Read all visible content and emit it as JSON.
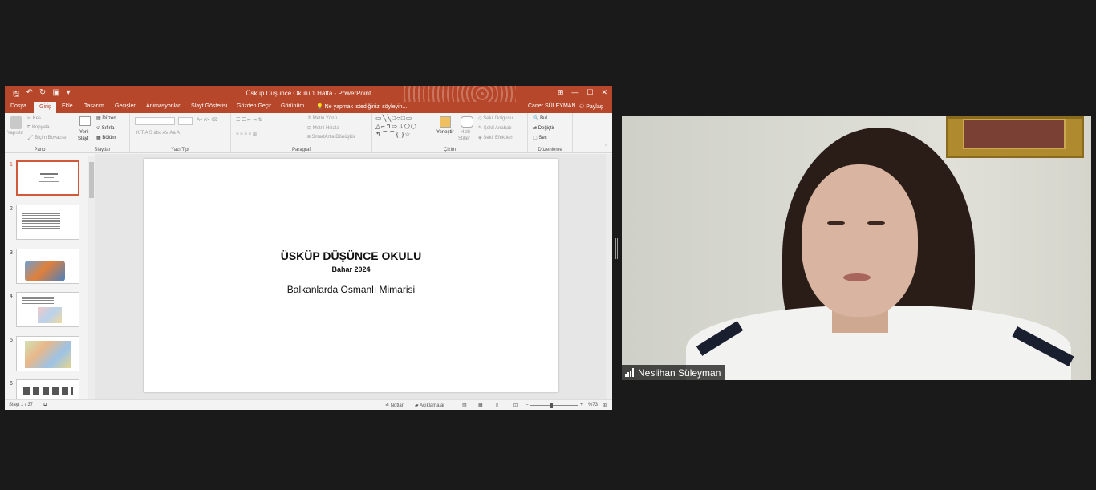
{
  "powerpoint": {
    "window_title": "Üsküp Düşünce Okulu 1.Hafta - PowerPoint",
    "tabs": [
      "Dosya",
      "Giriş",
      "Ekle",
      "Tasarım",
      "Geçişler",
      "Animasyonlar",
      "Slayt Gösterisi",
      "Gözden Geçir",
      "Görünüm"
    ],
    "active_tab": "Giriş",
    "tell_me": "Ne yapmak istediğinizi söyleyin...",
    "user_name": "Caner SÜLEYMAN",
    "share_label": "Paylaş",
    "ribbon": {
      "pano": {
        "label": "Pano",
        "paste": "Yapıştır",
        "cut": "Kes",
        "copy": "Kopyala",
        "format_painter": "Biçim Boyacısı"
      },
      "slaytlar": {
        "label": "Slaytlar",
        "new_slide": "Yeni",
        "new_slide2": "Slayt",
        "layout": "Düzen",
        "reset": "Sıfırla",
        "section": "Bölüm"
      },
      "yazi_tipi": {
        "label": "Yazı Tipi"
      },
      "paragraf": {
        "label": "Paragraf",
        "text_direction": "Metin Yönü",
        "align_text": "Metni Hizala",
        "smartart": "SmartArt'a Dönüştür"
      },
      "cizim": {
        "label": "Çizim",
        "arrange": "Yerleştir",
        "quick_styles1": "Hızlı",
        "quick_styles2": "Stiller",
        "shape_fill": "Şekil Dolgusu",
        "shape_outline": "Şekil Anahatı",
        "shape_effects": "Şekil Efektleri"
      },
      "duzenleme": {
        "label": "Düzenleme",
        "find": "Bul",
        "replace": "Değiştir",
        "select": "Seç"
      }
    },
    "thumbnails": [
      "1",
      "2",
      "3",
      "4",
      "5",
      "6"
    ],
    "slide": {
      "title": "ÜSKÜP DÜŞÜNCE OKULU",
      "subtitle": "Bahar 2024",
      "body": "Balkanlarda Osmanlı Mimarisi"
    },
    "status": {
      "slide_count": "Slayt 1 / 37",
      "notes": "Notlar",
      "comments": "Açıklamalar",
      "zoom": "%73"
    }
  },
  "participant": {
    "name": "Neslihan Süleyman"
  }
}
